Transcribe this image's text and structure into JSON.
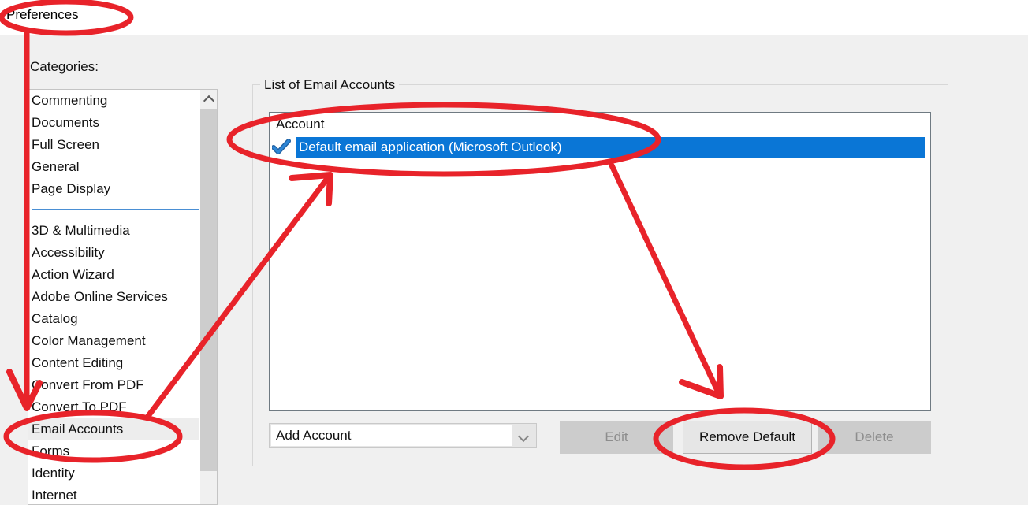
{
  "dialog": {
    "title": "Preferences",
    "categories_label": "Categories:"
  },
  "sidebar": {
    "items": [
      {
        "label": "Commenting",
        "selected": false
      },
      {
        "label": "Documents",
        "selected": false
      },
      {
        "label": "Full Screen",
        "selected": false
      },
      {
        "label": "General",
        "selected": false
      },
      {
        "label": "Page Display",
        "selected": false
      },
      {
        "separator": true
      },
      {
        "label": "3D & Multimedia",
        "selected": false
      },
      {
        "label": "Accessibility",
        "selected": false
      },
      {
        "label": "Action Wizard",
        "selected": false
      },
      {
        "label": "Adobe Online Services",
        "selected": false
      },
      {
        "label": "Catalog",
        "selected": false
      },
      {
        "label": "Color Management",
        "selected": false
      },
      {
        "label": "Content Editing",
        "selected": false
      },
      {
        "label": "Convert From PDF",
        "selected": false
      },
      {
        "label": "Convert To PDF",
        "selected": false
      },
      {
        "label": "Email Accounts",
        "selected": true
      },
      {
        "label": "Forms",
        "selected": false
      },
      {
        "label": "Identity",
        "selected": false
      },
      {
        "label": "Internet",
        "selected": false
      }
    ],
    "scroll_up_icon": "chevron-up-icon"
  },
  "main": {
    "group_title": "List of Email Accounts",
    "table": {
      "columns": [
        "Account"
      ],
      "rows": [
        {
          "account": "Default email application (Microsoft Outlook)",
          "icon": "blue-checkmark-icon",
          "selected": true
        }
      ]
    },
    "add_account": {
      "value": "Add Account",
      "placeholder": "Add Account",
      "arrow_icon": "chevron-down-icon"
    },
    "buttons": [
      {
        "label": "Edit",
        "enabled": false
      },
      {
        "label": "Remove Default",
        "enabled": true
      },
      {
        "label": "Delete",
        "enabled": false
      }
    ]
  },
  "annotations": {
    "color": "#e8232a",
    "marks": [
      "ellipse-around-preferences-title",
      "line-from-title-to-email-accounts",
      "ellipse-around-email-accounts",
      "ellipse-around-account-row",
      "arrow-from-email-accounts-to-account-row",
      "arrow-from-account-row-to-remove-default",
      "ellipse-around-remove-default"
    ]
  },
  "colors": {
    "selection_blue": "#0a76d6",
    "dialog_background": "#f0f0f0",
    "annotation_red": "#e8232a",
    "separator_blue": "#4a8fd4"
  }
}
